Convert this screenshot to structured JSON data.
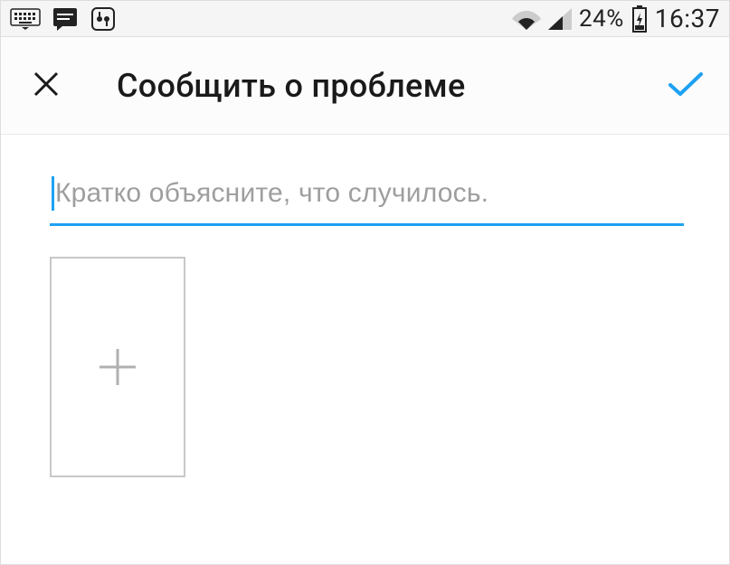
{
  "status_bar": {
    "battery_pct": "24%",
    "time": "16:37"
  },
  "header": {
    "title": "Сообщить о проблеме"
  },
  "form": {
    "placeholder": "Кратко объясните, что случилось.",
    "value": ""
  }
}
